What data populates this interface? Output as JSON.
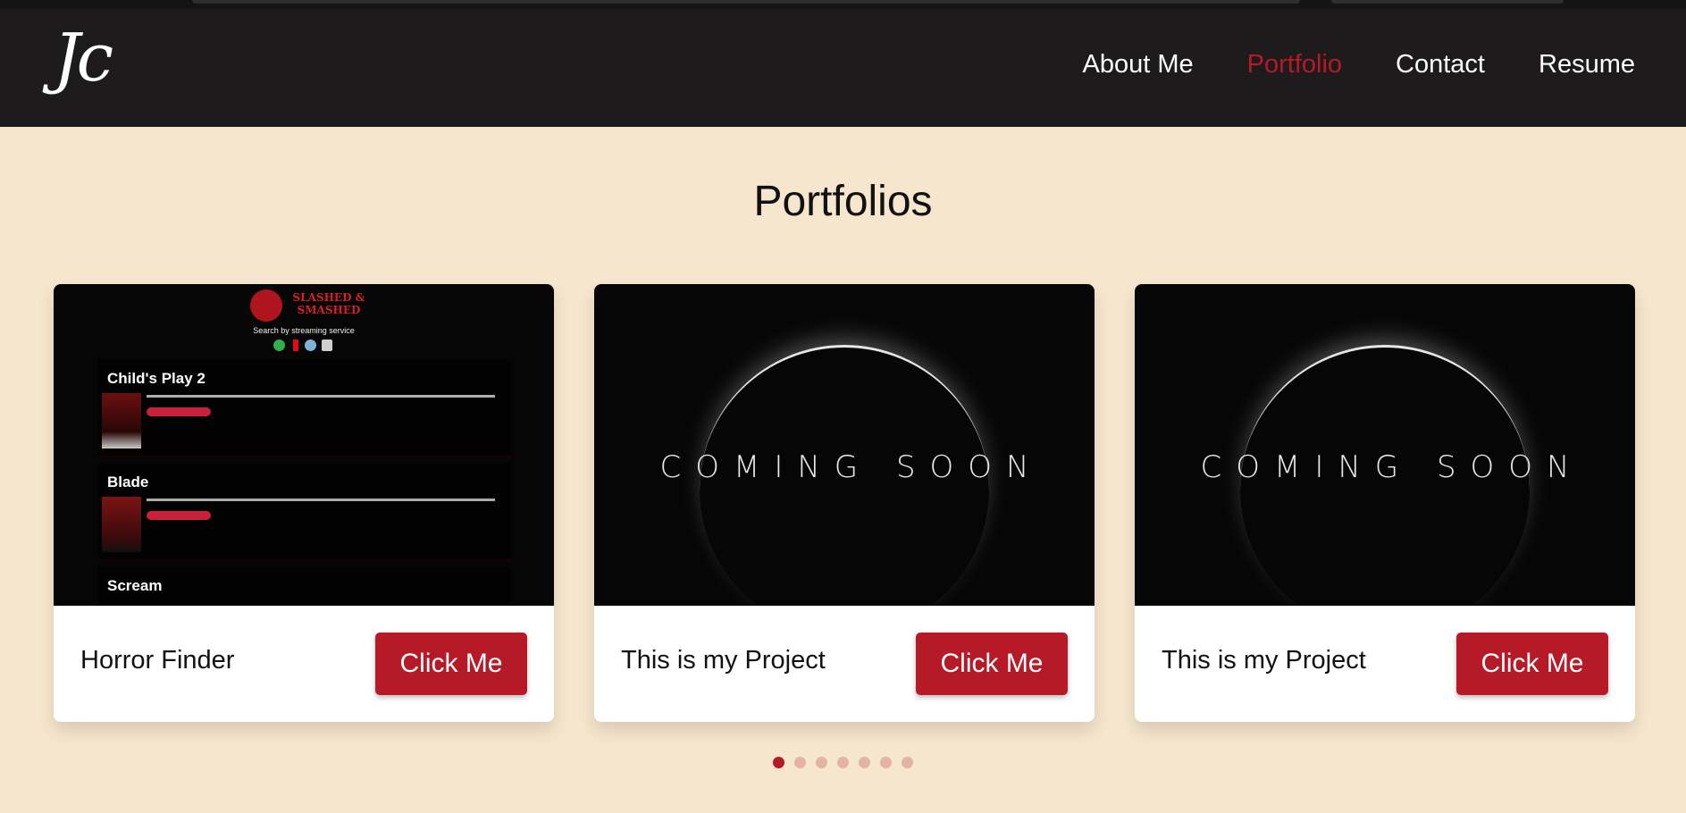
{
  "header": {
    "logo": "Jc",
    "nav": [
      {
        "label": "About Me",
        "active": false
      },
      {
        "label": "Portfolio",
        "active": true
      },
      {
        "label": "Contact",
        "active": false
      },
      {
        "label": "Resume",
        "active": false
      }
    ]
  },
  "page": {
    "heading": "Portfolios"
  },
  "cards": [
    {
      "title": "Horror Finder",
      "button": "Click Me",
      "preview": {
        "brand": "SLASHED & SMASHED",
        "subtitle": "Search by streaming service",
        "movies": [
          "Child's Play 2",
          "Blade",
          "Scream"
        ]
      }
    },
    {
      "title": "This is my Project",
      "button": "Click Me",
      "preview_text": "COMING SOON"
    },
    {
      "title": "This is my Project",
      "button": "Click Me",
      "preview_text": "COMING SOON"
    }
  ],
  "carousel": {
    "dots": 7,
    "active_index": 0
  },
  "colors": {
    "accent": "#b51a26",
    "background": "#f6e6cd",
    "header": "#1d1b1c"
  }
}
